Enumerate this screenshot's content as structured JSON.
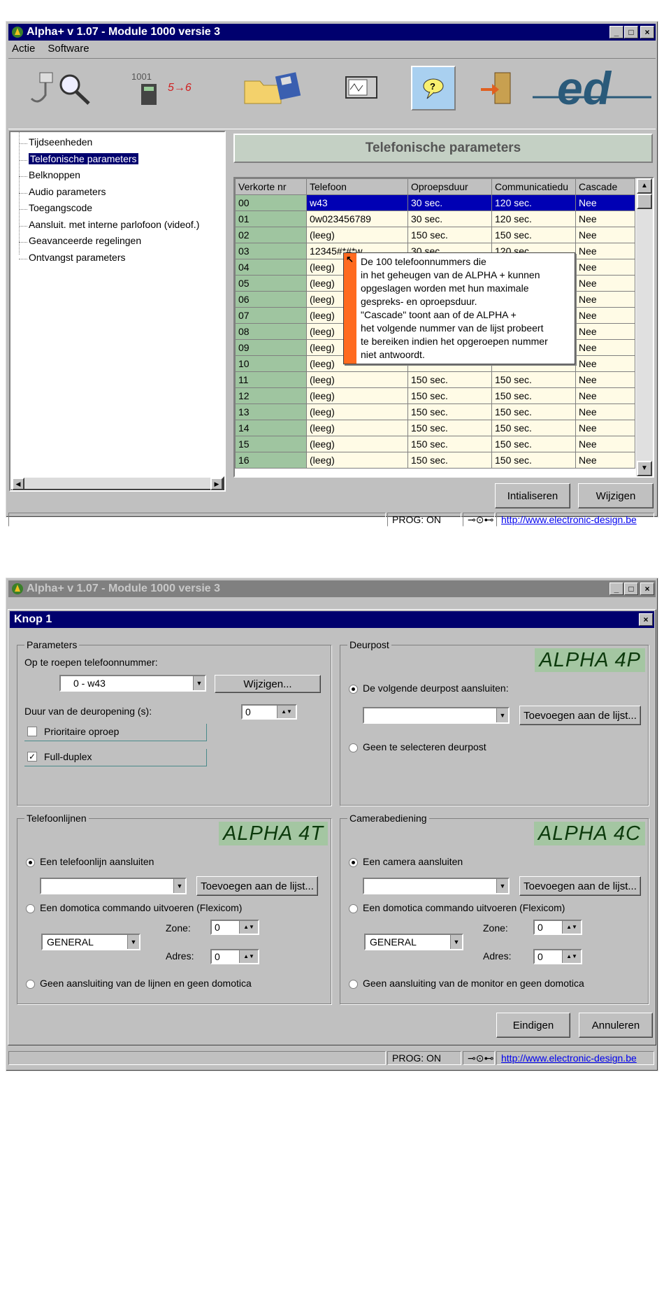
{
  "window1": {
    "title": "Alpha+ v 1.07 - Module 1000 versie 3",
    "title_buttons": [
      "_",
      "□",
      "×"
    ],
    "menu": [
      "Actie",
      "Software"
    ],
    "toolbar_icons": [
      "plug-search-icon",
      "binary-conversion-icon",
      "folder-disk-icon",
      "monitor-icon",
      "help-speech-icon",
      "exit-door-icon",
      "ed-logo-icon"
    ],
    "toolbar_text": {
      "conversion_label": "5→6",
      "binary_label": "1001"
    },
    "logo_text": "ed",
    "tree": [
      "Tijdseenheden",
      "Telefonische parameters",
      "Belknoppen",
      "Audio parameters",
      "Toegangscode",
      "Aansluit. met interne parlofoon (videof.)",
      "Geavanceerde regelingen",
      "Ontvangst parameters"
    ],
    "tree_selected": 1,
    "panel_title": "Telefonische parameters",
    "table": {
      "headers": [
        "Verkorte nr",
        "Telefoon",
        "Oproepsduur",
        "Communicatiedu",
        "Cascade"
      ],
      "rows": [
        [
          "00",
          "w43",
          "30 sec.",
          "120 sec.",
          "Nee"
        ],
        [
          "01",
          "0w023456789",
          "30 sec.",
          "120 sec.",
          "Nee"
        ],
        [
          "02",
          "(leeg)",
          "150 sec.",
          "150 sec.",
          "Nee"
        ],
        [
          "03",
          "12345#*#*w",
          "30 sec.",
          "120 sec.",
          "Nee"
        ],
        [
          "04",
          "(leeg)",
          "150 sec.",
          "150 sec.",
          "Nee"
        ],
        [
          "05",
          "(leeg)",
          "",
          "",
          "Nee"
        ],
        [
          "06",
          "(leeg)",
          "",
          "",
          "Nee"
        ],
        [
          "07",
          "(leeg)",
          "",
          "",
          "Nee"
        ],
        [
          "08",
          "(leeg)",
          "",
          "",
          "Nee"
        ],
        [
          "09",
          "(leeg)",
          "",
          "",
          "Nee"
        ],
        [
          "10",
          "(leeg)",
          "",
          "",
          "Nee"
        ],
        [
          "11",
          "(leeg)",
          "150 sec.",
          "150 sec.",
          "Nee"
        ],
        [
          "12",
          "(leeg)",
          "150 sec.",
          "150 sec.",
          "Nee"
        ],
        [
          "13",
          "(leeg)",
          "150 sec.",
          "150 sec.",
          "Nee"
        ],
        [
          "14",
          "(leeg)",
          "150 sec.",
          "150 sec.",
          "Nee"
        ],
        [
          "15",
          "(leeg)",
          "150 sec.",
          "150 sec.",
          "Nee"
        ],
        [
          "16",
          "(leeg)",
          "150 sec.",
          "150 sec.",
          "Nee"
        ]
      ],
      "selected_row": 0
    },
    "tooltip": [
      "De 100 telefoonnummers die",
      "in het geheugen van de ALPHA + kunnen",
      "opgeslagen worden met hun maximale",
      "gespreks- en oproepsduur.",
      "\"Cascade\" toont aan of de ALPHA +",
      "het volgende nummer van de lijst probeert",
      "te bereiken indien het opgeroepen nummer",
      "niet antwoordt."
    ],
    "buttons": {
      "init": "Intialiseren",
      "change": "Wijzigen"
    },
    "status": {
      "prog": "PROG: ON",
      "url": "http://www.electronic-design.be"
    }
  },
  "window2": {
    "title": "Alpha+ v 1.07 - Module 1000 versie 3",
    "dialog_title": "Knop 1",
    "parameters": {
      "label": "Parameters",
      "number_label": "Op te roepen telefoonnummer:",
      "number_value": "0 - w43",
      "change_button": "Wijzigen...",
      "duration_label": "Duur van de deuropening (s):",
      "duration_value": "0",
      "priority_label": "Prioritaire oproep",
      "priority_checked": false,
      "duplex_label": "Full-duplex",
      "duplex_checked": true
    },
    "deurpost": {
      "label": "Deurpost",
      "brand": "ALPHA 4P",
      "option_connect": "De volgende deurpost aansluiten:",
      "add_button": "Toevoegen aan de lijst...",
      "option_none": "Geen te selecteren deurpost",
      "select_value": ""
    },
    "telefoonlijnen": {
      "label": "Telefoonlijnen",
      "brand": "ALPHA 4T",
      "option_connect": "Een telefoonlijn aansluiten",
      "add_button": "Toevoegen aan de lijst...",
      "option_domotica": "Een domotica commando uitvoeren (Flexicom)",
      "general": "GENERAL",
      "zone_label": "Zone:",
      "zone_value": "0",
      "adres_label": "Adres:",
      "adres_value": "0",
      "option_none": "Geen aansluiting van de lijnen en geen domotica"
    },
    "camerabediening": {
      "label": "Camerabediening",
      "brand": "ALPHA 4C",
      "option_connect": "Een camera aansluiten",
      "add_button": "Toevoegen aan de lijst...",
      "option_domotica": "Een domotica commando uitvoeren (Flexicom)",
      "general": "GENERAL",
      "zone_label": "Zone:",
      "zone_value": "0",
      "adres_label": "Adres:",
      "adres_value": "0",
      "option_none": "Geen aansluiting van de monitor en geen domotica"
    },
    "buttons": {
      "finish": "Eindigen",
      "cancel": "Annuleren"
    },
    "status": {
      "prog": "PROG: ON",
      "url": "http://www.electronic-design.be"
    }
  },
  "colors": {
    "titlebar": "#00006e",
    "selection": "#0000b4",
    "key_cell": "#9fc5a0",
    "value_cell": "#fffbe6",
    "tooltip_accent": "#ff6a1f",
    "brand_bg": "#a4c6a2"
  }
}
